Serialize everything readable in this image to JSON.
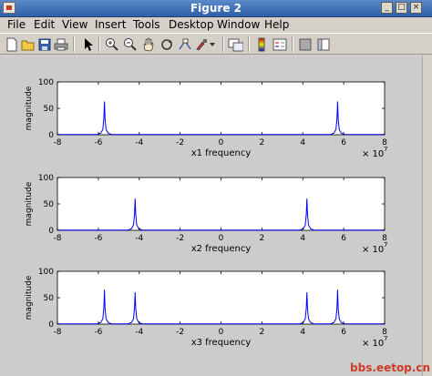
{
  "window": {
    "title": "Figure 2"
  },
  "menu": [
    "File",
    "Edit",
    "View",
    "Insert",
    "Tools",
    "Desktop",
    "Window",
    "Help"
  ],
  "toolbar_icons": [
    "new-figure-icon",
    "open-file-icon",
    "save-icon",
    "print-icon",
    "select-arrow-icon",
    "zoom-in-icon",
    "zoom-out-icon",
    "pan-hand-icon",
    "rotate-3d-icon",
    "data-cursor-icon",
    "brush-icon",
    "link-plot-icon",
    "colorbar-icon",
    "legend-icon",
    "hide-plot-tools-icon",
    "show-plot-tools-icon"
  ],
  "watermark": "bbs.eetop.cn",
  "colors": {
    "line": "#0000ff",
    "figure_bg": "#cccccc",
    "axes_bg": "#ffffff"
  },
  "chart_data": [
    {
      "type": "line",
      "title": "",
      "xlabel": "x1 frequency",
      "ylabel": "magnitude",
      "xlim": [
        -8,
        8
      ],
      "ylim": [
        0,
        100
      ],
      "xticks": [
        "-8",
        "-6",
        "-4",
        "-2",
        "0",
        "2",
        "4",
        "6",
        "8"
      ],
      "yticks": [
        "0",
        "50",
        "100"
      ],
      "x_exponent": "7",
      "peaks": [
        {
          "x": -5.7,
          "y": 63
        },
        {
          "x": 5.7,
          "y": 63
        }
      ]
    },
    {
      "type": "line",
      "title": "",
      "xlabel": "x2 frequency",
      "ylabel": "magnitude",
      "xlim": [
        -8,
        8
      ],
      "ylim": [
        0,
        100
      ],
      "xticks": [
        "-8",
        "-6",
        "-4",
        "-2",
        "0",
        "2",
        "4",
        "6",
        "8"
      ],
      "yticks": [
        "0",
        "50",
        "100"
      ],
      "x_exponent": "7",
      "peaks": [
        {
          "x": -4.2,
          "y": 60
        },
        {
          "x": 4.2,
          "y": 60
        }
      ]
    },
    {
      "type": "line",
      "title": "",
      "xlabel": "x3 frequency",
      "ylabel": "magnitude",
      "xlim": [
        -8,
        8
      ],
      "ylim": [
        0,
        100
      ],
      "xticks": [
        "-8",
        "-6",
        "-4",
        "-2",
        "0",
        "2",
        "4",
        "6",
        "8"
      ],
      "yticks": [
        "0",
        "50",
        "100"
      ],
      "x_exponent": "7",
      "peaks": [
        {
          "x": -5.7,
          "y": 65
        },
        {
          "x": -4.2,
          "y": 60
        },
        {
          "x": 4.2,
          "y": 60
        },
        {
          "x": 5.7,
          "y": 65
        }
      ]
    }
  ]
}
